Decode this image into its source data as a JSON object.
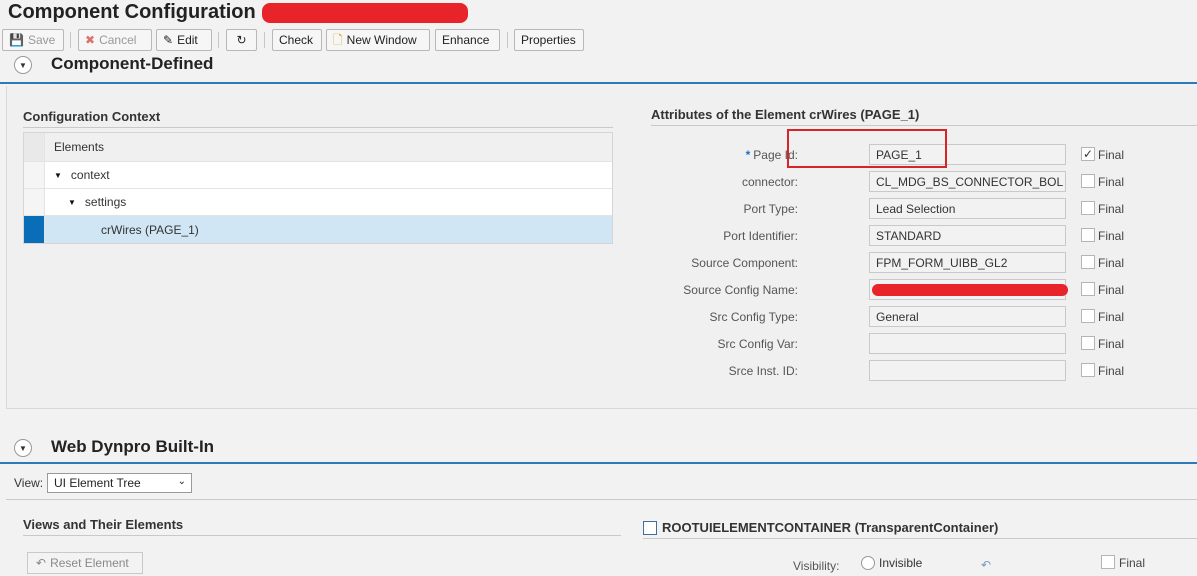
{
  "page": {
    "title": "Component Configuration"
  },
  "toolbar": {
    "save": "Save",
    "cancel": "Cancel",
    "edit": "Edit",
    "check": "Check",
    "new_window": "New Window",
    "enhance": "Enhance",
    "properties": "Properties"
  },
  "component_defined": {
    "title": "Component-Defined",
    "context_title": "Configuration Context",
    "tree": {
      "header": "Elements",
      "rows": [
        {
          "label": "context"
        },
        {
          "label": "settings"
        },
        {
          "label": "crWires (PAGE_1)"
        }
      ]
    },
    "attributes": {
      "title": "Attributes of the Element crWires (PAGE_1)",
      "required_marker": "*",
      "final_label": "Final",
      "rows": [
        {
          "label": "Page Id:",
          "value": "PAGE_1",
          "final": true
        },
        {
          "label": "connector:",
          "value": "CL_MDG_BS_CONNECTOR_BOL",
          "final": false
        },
        {
          "label": "Port Type:",
          "value": "Lead Selection",
          "final": false
        },
        {
          "label": "Port Identifier:",
          "value": "STANDARD",
          "final": false
        },
        {
          "label": "Source Component:",
          "value": "FPM_FORM_UIBB_GL2",
          "final": false
        },
        {
          "label": "Source Config Name:",
          "value": "",
          "final": false
        },
        {
          "label": "Src Config Type:",
          "value": "General",
          "final": false
        },
        {
          "label": "Src Config Var:",
          "value": "",
          "final": false
        },
        {
          "label": "Srce Inst. ID:",
          "value": "",
          "final": false
        }
      ]
    }
  },
  "web_dynpro": {
    "title": "Web Dynpro Built-In",
    "view_label": "View:",
    "view_value": "UI Element Tree",
    "views_title": "Views and Their Elements",
    "reset_button": "Reset Element",
    "root_container": "ROOTUIELEMENTCONTAINER (TransparentContainer)",
    "visibility_label": "Visibility:",
    "invisible_label": "Invisible",
    "final_label": "Final"
  },
  "colors": {
    "accent": "#2d7ab8",
    "selection": "#0a6db7",
    "highlight": "#d8232a"
  }
}
